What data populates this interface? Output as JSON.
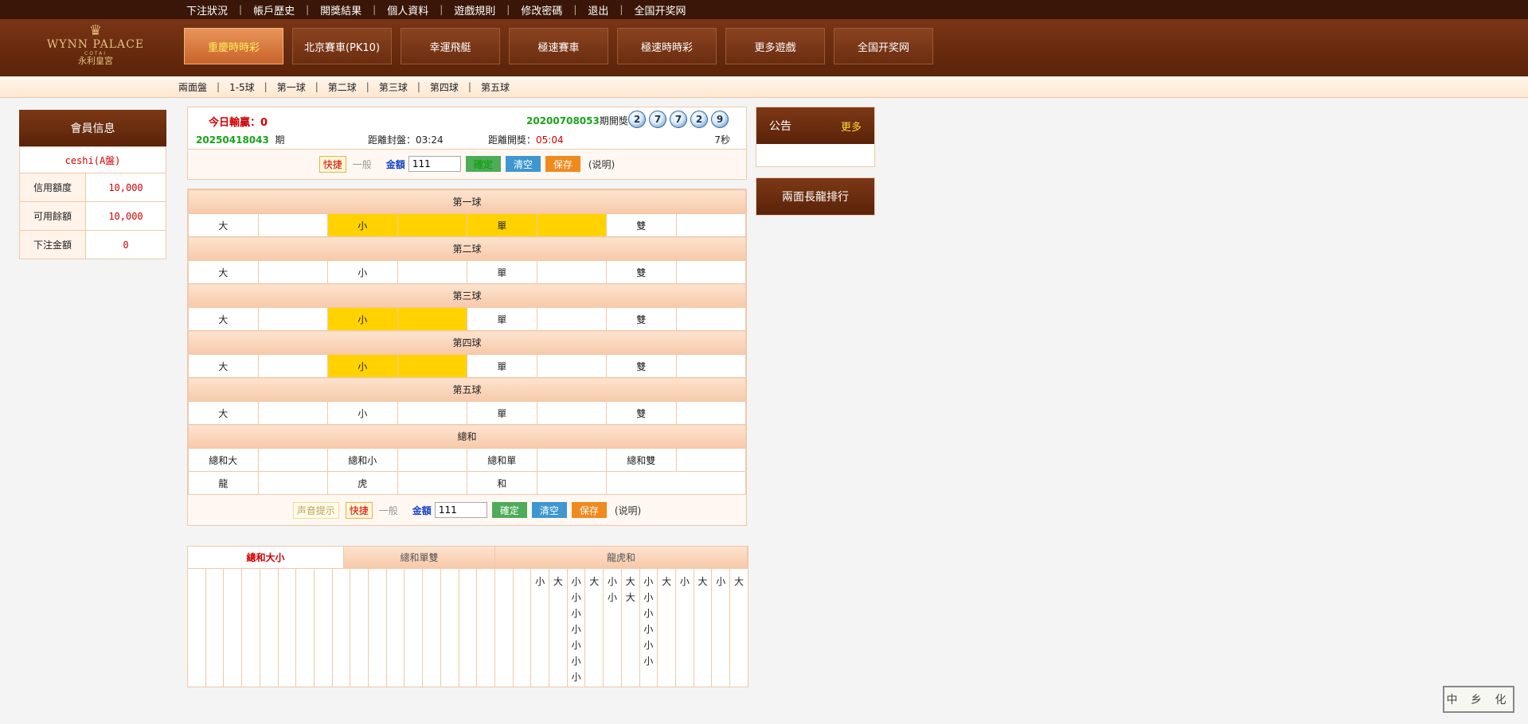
{
  "topnav": [
    "下注狀況",
    "帳戶歷史",
    "開獎結果",
    "個人資料",
    "遊戲規則",
    "修改密碼",
    "退出",
    "全国开奖网"
  ],
  "logo": {
    "name": "WYNN PALACE",
    "sub": "COTAI",
    "cn": "永利皇宮"
  },
  "games": [
    "重慶時時彩",
    "北京賽車(PK10)",
    "幸運飛艇",
    "極速賽車",
    "極速時時彩",
    "更多遊戲",
    "全国开奖网"
  ],
  "subnav": [
    "兩面盤",
    "1-5球",
    "第一球",
    "第二球",
    "第三球",
    "第四球",
    "第五球"
  ],
  "member": {
    "title": "會員信息",
    "user": "ceshi(A盤)",
    "rows": [
      {
        "label": "信用額度",
        "value": "10,000"
      },
      {
        "label": "可用餘額",
        "value": "10,000"
      },
      {
        "label": "下注金額",
        "value": "0"
      }
    ]
  },
  "info": {
    "profit_label": "今日輸贏：",
    "profit_value": "0",
    "last_issue": "20200708053",
    "last_issue_suffix": "期開獎：",
    "balls": [
      "2",
      "7",
      "7",
      "2",
      "9"
    ],
    "current_issue": "20250418043",
    "issue_suffix": "期",
    "close_label": "距離封盤：",
    "close_time": "03:24",
    "open_label": "距離開獎：",
    "open_time": "05:04",
    "seconds": "7秒"
  },
  "controls": {
    "sound": "声音提示",
    "quick": "快捷",
    "normal": "一般",
    "amount_label": "金額",
    "amount": "111",
    "confirm": "確定",
    "clear": "清空",
    "save": "保存",
    "explain": "(说明)"
  },
  "sections": [
    {
      "title": "第一球",
      "opts": [
        "大",
        "小",
        "單",
        "雙"
      ],
      "highlight": [
        1,
        2
      ]
    },
    {
      "title": "第二球",
      "opts": [
        "大",
        "小",
        "單",
        "雙"
      ],
      "highlight": []
    },
    {
      "title": "第三球",
      "opts": [
        "大",
        "小",
        "單",
        "雙"
      ],
      "highlight": [
        1
      ]
    },
    {
      "title": "第四球",
      "opts": [
        "大",
        "小",
        "單",
        "雙"
      ],
      "highlight": [
        1
      ]
    },
    {
      "title": "第五球",
      "opts": [
        "大",
        "小",
        "單",
        "雙"
      ],
      "highlight": []
    }
  ],
  "total": {
    "title": "總和",
    "row1": [
      "總和大",
      "總和小",
      "總和單",
      "總和雙"
    ],
    "row2": [
      "龍",
      "虎",
      "和"
    ]
  },
  "stats": {
    "tabs": [
      "總和大小",
      "總和單雙",
      "龍虎和"
    ],
    "columns": [
      [],
      [],
      [],
      [],
      [],
      [],
      [],
      [],
      [],
      [],
      [],
      [],
      [],
      [],
      [],
      [],
      [],
      [],
      [],
      [
        "小"
      ],
      [
        "大"
      ],
      [
        "小",
        "小",
        "小",
        "小",
        "小",
        "小",
        "小"
      ],
      [
        "大"
      ],
      [
        "小",
        "小"
      ],
      [
        "大",
        "大"
      ],
      [
        "小",
        "小",
        "小",
        "小",
        "小",
        "小"
      ],
      [
        "大"
      ],
      [
        "小"
      ],
      [
        "大"
      ],
      [
        "小"
      ],
      [
        "大"
      ]
    ]
  },
  "notice": {
    "title": "公告",
    "more": "更多"
  },
  "rank_button": "兩面長龍排行",
  "seal_text": "中乡化"
}
